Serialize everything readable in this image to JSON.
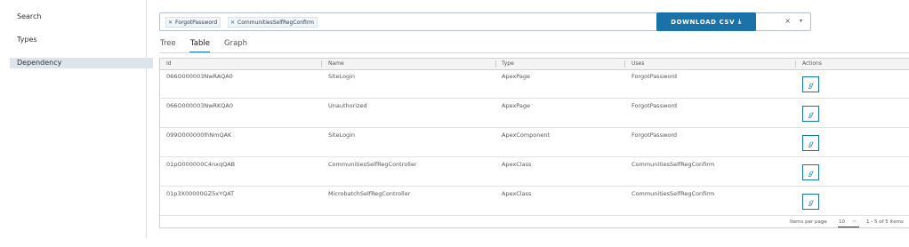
{
  "sidebar": {
    "items": [
      {
        "label": "Search"
      },
      {
        "label": "Types"
      },
      {
        "label": "Dependency",
        "active": true
      }
    ]
  },
  "filter": {
    "chips": [
      {
        "label": "ForgotPassword"
      },
      {
        "label": "CommunitiesSelfRegConfirm"
      }
    ],
    "clear_glyph": "×",
    "dropdown_glyph": "▾"
  },
  "toolbar": {
    "download_label": "DOWNLOAD CSV",
    "download_icon": "⤓"
  },
  "tabs": [
    {
      "label": "Tree"
    },
    {
      "label": "Table",
      "active": true
    },
    {
      "label": "Graph"
    }
  ],
  "table": {
    "columns": [
      "Id",
      "Name",
      "Type",
      "Uses",
      "Actions"
    ],
    "rows": [
      {
        "id": "066O000003NwRAQA0",
        "name": "SiteLogin",
        "type": "ApexPage",
        "uses": "ForgotPassword"
      },
      {
        "id": "066O000003NwRKQA0",
        "name": "Unauthorized",
        "type": "ApexPage",
        "uses": "ForgotPassword"
      },
      {
        "id": "099O000000lhNmQAK",
        "name": "SiteLogin",
        "type": "ApexComponent",
        "uses": "ForgotPassword"
      },
      {
        "id": "01pO000000C4nxqQAB",
        "name": "CommunitiesSelfRegController",
        "type": "ApexClass",
        "uses": "CommunitiesSelfRegConfirm"
      },
      {
        "id": "01p3X00000GZ5xYQAT",
        "name": "MicrobatchSelfRegController",
        "type": "ApexClass",
        "uses": "CommunitiesSelfRegConfirm"
      }
    ],
    "action_glyph": "ℊ"
  },
  "pagination": {
    "items_per_page_label": "Items per page",
    "page_size": "10",
    "range": "1 - 5 of 5 items"
  }
}
